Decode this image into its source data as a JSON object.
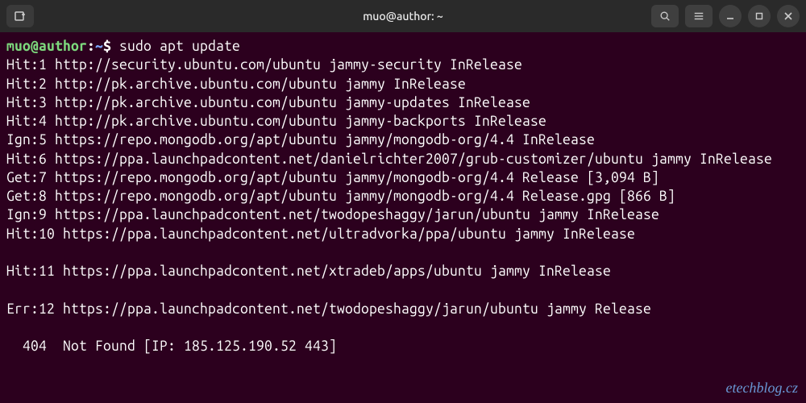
{
  "titlebar": {
    "title": "muo@author: ~",
    "new_tab_icon": "new-tab",
    "search_icon": "search",
    "menu_icon": "menu",
    "minimize_icon": "minimize",
    "maximize_icon": "maximize",
    "close_icon": "close"
  },
  "prompt": {
    "user_host": "muo@author",
    "sep1": ":",
    "path": "~",
    "sep2": "$",
    "command": "sudo apt update"
  },
  "output_lines": [
    "Hit:1 http://security.ubuntu.com/ubuntu jammy-security InRelease",
    "Hit:2 http://pk.archive.ubuntu.com/ubuntu jammy InRelease",
    "Hit:3 http://pk.archive.ubuntu.com/ubuntu jammy-updates InRelease",
    "Hit:4 http://pk.archive.ubuntu.com/ubuntu jammy-backports InRelease",
    "Ign:5 https://repo.mongodb.org/apt/ubuntu jammy/mongodb-org/4.4 InRelease",
    "Hit:6 https://ppa.launchpadcontent.net/danielrichter2007/grub-customizer/ubuntu jammy InRelease",
    "Get:7 https://repo.mongodb.org/apt/ubuntu jammy/mongodb-org/4.4 Release [3,094 B]",
    "Get:8 https://repo.mongodb.org/apt/ubuntu jammy/mongodb-org/4.4 Release.gpg [866 B]",
    "Ign:9 https://ppa.launchpadcontent.net/twodopeshaggy/jarun/ubuntu jammy InRelease",
    "Hit:10 https://ppa.launchpadcontent.net/ultradvorka/ppa/ubuntu jammy InRelease",
    "",
    "Hit:11 https://ppa.launchpadcontent.net/xtradeb/apps/ubuntu jammy InRelease",
    "",
    "Err:12 https://ppa.launchpadcontent.net/twodopeshaggy/jarun/ubuntu jammy Release",
    "",
    "  404  Not Found [IP: 185.125.190.52 443]"
  ],
  "watermark": "etechblog.cz"
}
